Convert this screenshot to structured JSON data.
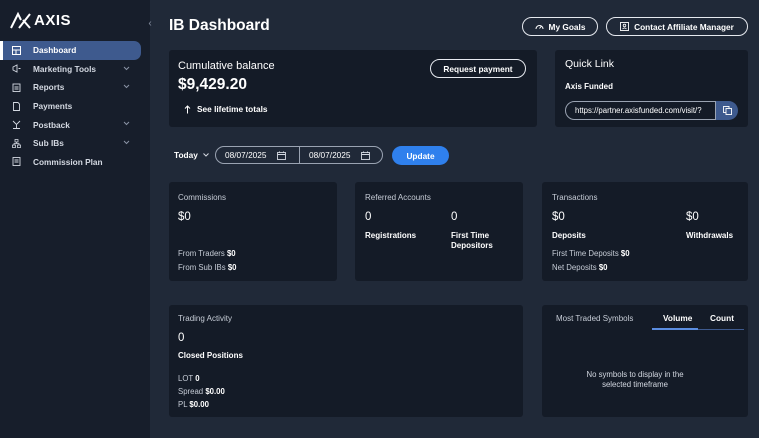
{
  "sidebar": {
    "logo_text": "AXIS",
    "items": [
      {
        "label": "Dashboard",
        "icon": "dashboard-icon",
        "active": true
      },
      {
        "label": "Marketing Tools",
        "icon": "megaphone-icon",
        "has_chevron": true
      },
      {
        "label": "Reports",
        "icon": "clipboard-icon",
        "has_chevron": true
      },
      {
        "label": "Payments",
        "icon": "document-icon"
      },
      {
        "label": "Postback",
        "icon": "split-icon",
        "has_chevron": true
      },
      {
        "label": "Sub IBs",
        "icon": "network-icon",
        "has_chevron": true
      },
      {
        "label": "Commission Plan",
        "icon": "list-icon"
      }
    ]
  },
  "header": {
    "title": "IB Dashboard",
    "my_goals": "My Goals",
    "contact_manager": "Contact Affiliate Manager"
  },
  "balance": {
    "label": "Cumulative balance",
    "amount": "$9,429.20",
    "lifetime_link": "See lifetime totals",
    "request_payment": "Request payment"
  },
  "quick_link": {
    "title": "Quick Link",
    "subtitle": "Axis Funded",
    "url": "https://partner.axisfunded.com/visit/?"
  },
  "filters": {
    "period": "Today",
    "date_from": "08/07/2025",
    "date_to": "08/07/2025",
    "update": "Update"
  },
  "commissions": {
    "label": "Commissions",
    "amount": "$0",
    "from_traders_label": "From Traders",
    "from_traders_value": "$0",
    "from_sub_ibs_label": "From Sub IBs",
    "from_sub_ibs_value": "$0"
  },
  "referred": {
    "label": "Referred Accounts",
    "registrations_value": "0",
    "registrations_label": "Registrations",
    "ftd_value": "0",
    "ftd_label_1": "First Time",
    "ftd_label_2": "Depositors"
  },
  "transactions": {
    "label": "Transactions",
    "deposits_value": "$0",
    "deposits_label": "Deposits",
    "withdrawals_value": "$0",
    "withdrawals_label": "Withdrawals",
    "ftd_label": "First Time Deposits",
    "ftd_value": "$0",
    "net_label": "Net Deposits",
    "net_value": "$0"
  },
  "trading": {
    "label": "Trading Activity",
    "closed_value": "0",
    "closed_label": "Closed Positions",
    "lot_label": "LOT",
    "lot_value": "0",
    "spread_label": "Spread",
    "spread_value": "$0.00",
    "pl_label": "PL",
    "pl_value": "$0.00"
  },
  "symbols": {
    "label": "Most Traded Symbols",
    "tab_volume": "Volume",
    "tab_count": "Count",
    "empty_line1": "No symbols to display in the",
    "empty_line2": "selected timeframe"
  }
}
